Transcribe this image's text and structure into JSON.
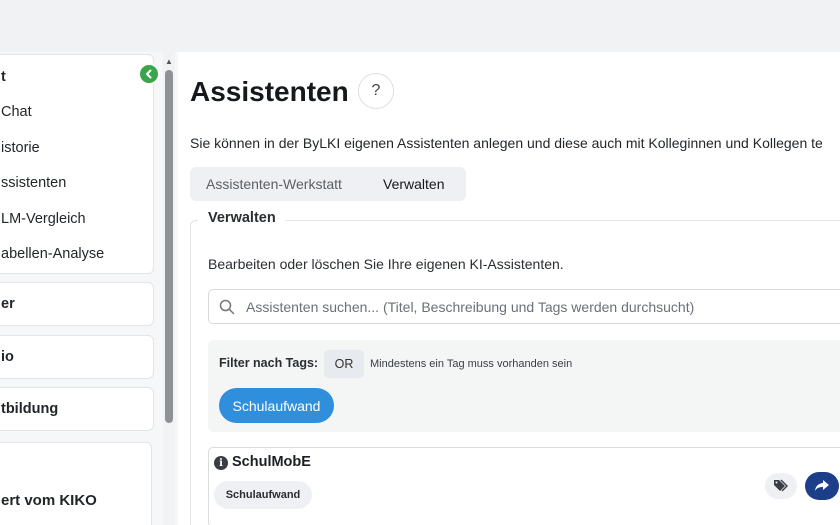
{
  "sidebar": {
    "main_items": [
      "t",
      "Chat",
      "istorie",
      "ssistenten",
      "LM-Vergleich",
      "abellen-Analyse"
    ],
    "section_er": "er",
    "section_io": "io",
    "section_fortbildung": "tbildung",
    "kiko_text": "ert vom KIKO",
    "collapse_icon": "chevron-left-icon"
  },
  "page": {
    "title": "Assistenten",
    "help_label": "?",
    "intro": "Sie können in der ByLKI eigenen Assistenten anlegen und diese auch mit Kolleginnen und Kollegen te"
  },
  "tabs": [
    {
      "label": "Assistenten-Werkstatt",
      "active": false
    },
    {
      "label": "Verwalten",
      "active": true
    }
  ],
  "manage": {
    "legend": "Verwalten",
    "description": "Bearbeiten oder löschen Sie Ihre eigenen KI-Assistenten.",
    "search_placeholder": "Assistenten suchen... (Titel, Beschreibung und Tags werden durchsucht)"
  },
  "filter": {
    "label": "Filter nach Tags:",
    "mode": "OR",
    "mode_description": "Mindestens ein Tag muss vorhanden sein",
    "tags": [
      "Schulaufwand"
    ]
  },
  "assistants": [
    {
      "title": "SchulMobE",
      "tags": [
        "Schulaufwand"
      ]
    }
  ],
  "colors": {
    "accent_green": "#3aa54a",
    "tag_blue": "#2f8fdc",
    "share_navy": "#1d3f8a"
  }
}
